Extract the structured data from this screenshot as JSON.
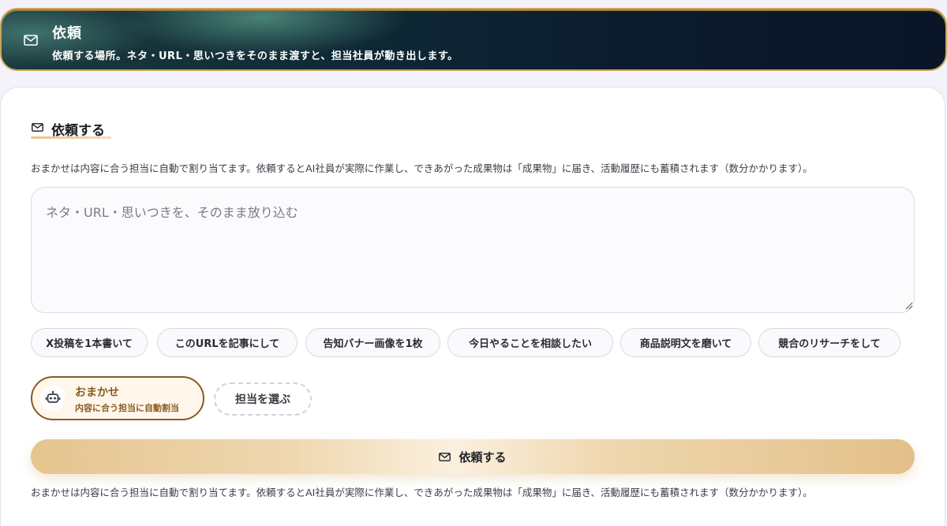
{
  "header": {
    "icon": "mail-icon",
    "title": "依頼",
    "subtitle": "依頼する場所。ネタ・URL・思いつきをそのまま渡すと、担当社員が動き出します。"
  },
  "section": {
    "icon": "mail-icon",
    "title": "依頼する",
    "description": "おまかせは内容に合う担当に自動で割り当てます。依頼するとAI社員が実際に作業し、できあがった成果物は「成果物」に届き、活動履歴にも蓄積されます（数分かかります）。"
  },
  "request_input": {
    "placeholder": "ネタ・URL・思いつきを、そのまま放り込む",
    "value": ""
  },
  "suggestions": [
    {
      "label": "X投稿を1本書いて"
    },
    {
      "label": "このURLを記事にして"
    },
    {
      "label": "告知バナー画像を1枚"
    },
    {
      "label": "今日やることを相談したい"
    },
    {
      "label": "商品説明文を磨いて"
    },
    {
      "label": "競合のリサーチをして"
    }
  ],
  "assign": {
    "auto": {
      "icon": "robot-icon",
      "title": "おまかせ",
      "subtitle": "内容に合う担当に自動割当",
      "selected": true,
      "color": "#8a5a1e"
    },
    "choose_label": "担当を選ぶ"
  },
  "submit": {
    "icon": "mail-icon",
    "label": "依頼する"
  },
  "footer_note": "おまかせは内容に合う担当に自動で割り当てます。依頼するとAI社員が実際に作業し、できあがった成果物は「成果物」に届き、活動履歴にも蓄積されます（数分かかります）。"
}
